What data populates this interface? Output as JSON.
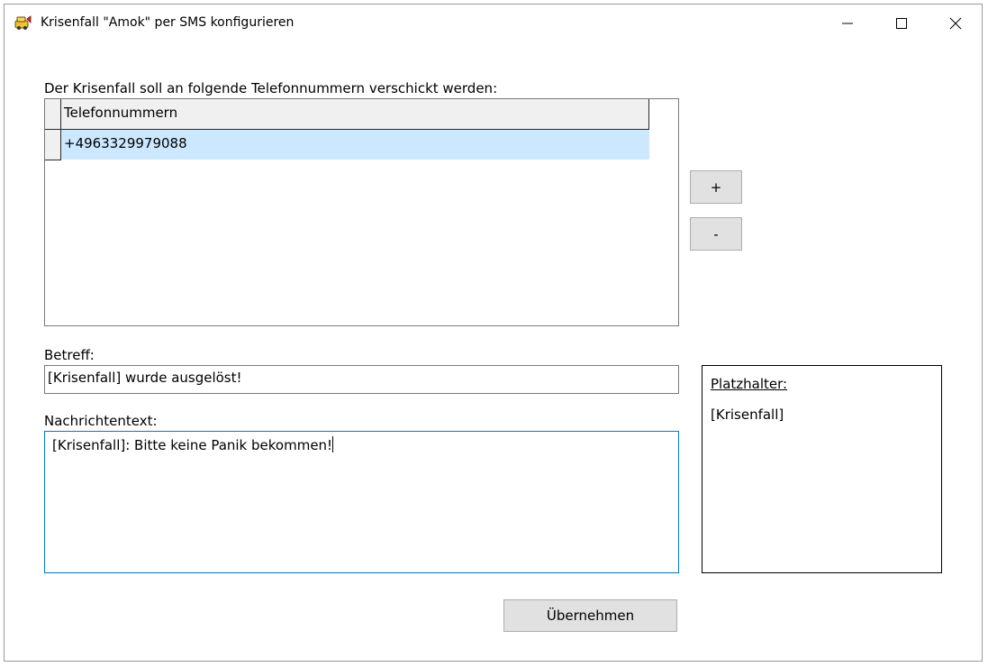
{
  "window": {
    "title": "Krisenfall \"Amok\" per SMS konfigurieren",
    "icon": "app-icon",
    "controls": {
      "minimize": "minimize-icon",
      "maximize": "maximize-icon",
      "close": "close-icon"
    }
  },
  "recipients": {
    "label": "Der Krisenfall soll an folgende Telefonnummern verschickt werden:",
    "column_header": "Telefonnummern",
    "rows": [
      "+4963329979088"
    ],
    "add_label": "+",
    "remove_label": "-"
  },
  "subject": {
    "label": "Betreff:",
    "value": "[Krisenfall] wurde ausgelöst!"
  },
  "message": {
    "label": "Nachrichtentext:",
    "value": "[Krisenfall]: Bitte keine Panik bekommen!"
  },
  "placeholders": {
    "title": "Platzhalter:",
    "items": [
      "[Krisenfall]"
    ]
  },
  "apply_label": "Übernehmen",
  "colors": {
    "selected_row": "#cce8ff",
    "focus_border": "#0078d7",
    "button_face": "#e1e1e1"
  }
}
